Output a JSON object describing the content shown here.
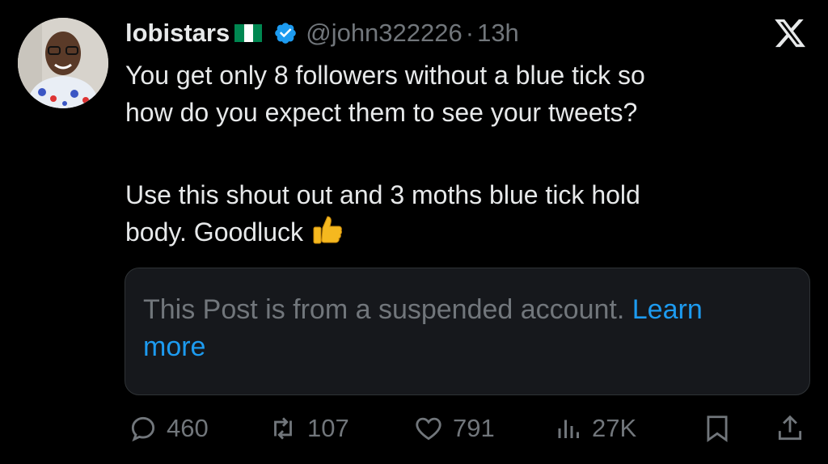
{
  "tweet": {
    "display_name": "lobistars",
    "handle": "@john322226",
    "separator": "·",
    "time": "13h",
    "text_lines": [
      "You get only 8 followers without a blue tick so",
      "how do you expect them to see your tweets?"
    ],
    "text_lines_2": [
      "Use this shout out and 3 moths blue tick hold",
      "body. Goodluck"
    ],
    "emoji": "thumbs-up"
  },
  "notice": {
    "text": "This Post is from a suspended account.",
    "link_text_1": "Learn",
    "link_text_2": "more"
  },
  "actions": {
    "replies": "460",
    "reposts": "107",
    "likes": "791",
    "views": "27K"
  },
  "colors": {
    "background": "#000000",
    "text": "#e7e9ea",
    "muted": "#71767b",
    "link": "#1d9bf0",
    "verified": "#1d9bf0",
    "flag_green": "#008751"
  },
  "icons": [
    "verified-badge-icon",
    "x-logo-icon",
    "reply-icon",
    "repost-icon",
    "like-icon",
    "views-icon",
    "bookmark-icon",
    "share-icon",
    "thumbs-up-emoji"
  ]
}
